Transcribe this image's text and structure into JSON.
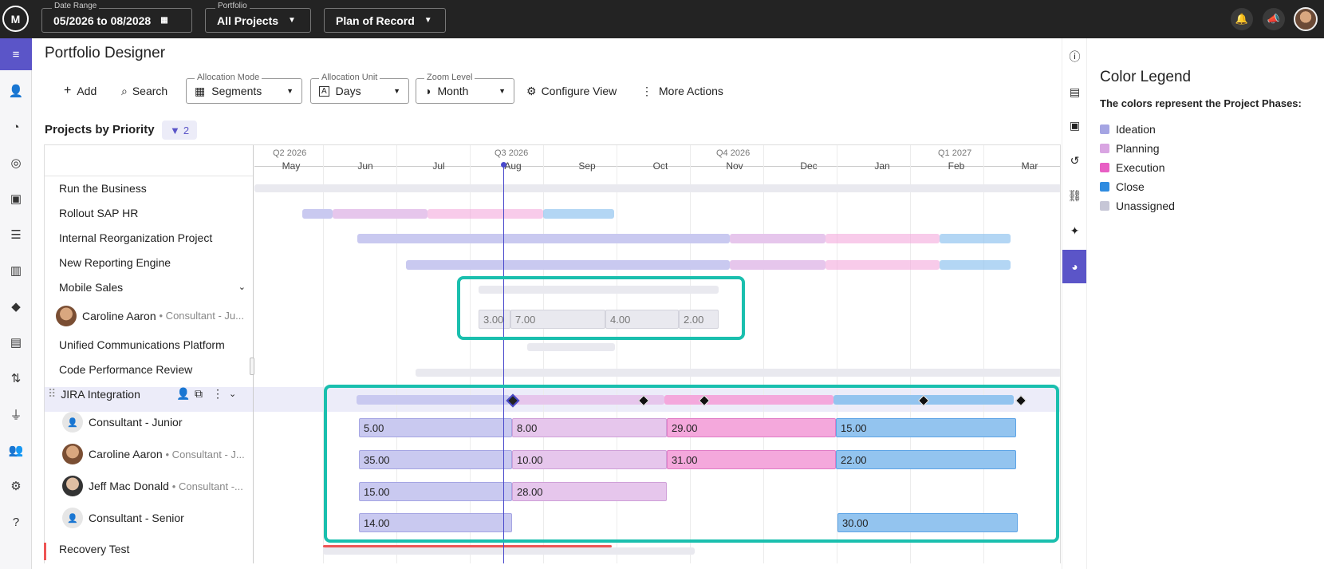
{
  "topbar": {
    "logo_text": "M",
    "date_range": {
      "label": "Date Range",
      "value": "05/2026 to 08/2028"
    },
    "portfolio": {
      "label": "Portfolio",
      "value": "All Projects"
    },
    "scenario": {
      "value": "Plan of Record"
    }
  },
  "page": {
    "title": "Portfolio Designer"
  },
  "toolbar": {
    "add_label": "Add",
    "search_label": "Search",
    "allocation_mode": {
      "label": "Allocation Mode",
      "value": "Segments"
    },
    "allocation_unit": {
      "label": "Allocation Unit",
      "value": "Days"
    },
    "zoom_level": {
      "label": "Zoom Level",
      "value": "Month"
    },
    "configure_label": "Configure View",
    "more_label": "More Actions"
  },
  "section": {
    "title": "Projects by Priority",
    "filter_count": "2"
  },
  "timeline": {
    "quarters": [
      "Q2 2026",
      "Q3 2026",
      "Q4 2026",
      "Q1 2027"
    ],
    "months": [
      "May",
      "Jun",
      "Jul",
      "Aug",
      "Sep",
      "Oct",
      "Nov",
      "Dec",
      "Jan",
      "Feb",
      "Mar"
    ]
  },
  "rows": [
    {
      "name": "Run the Business"
    },
    {
      "name": "Rollout SAP HR"
    },
    {
      "name": "Internal Reorganization Project"
    },
    {
      "name": "New Reporting Engine"
    },
    {
      "name": "Mobile Sales"
    },
    {
      "name": "Caroline Aaron",
      "sub": "• Consultant - Ju..."
    },
    {
      "name": "Unified Communications Platform"
    },
    {
      "name": "Code Performance Review"
    },
    {
      "name": "JIRA Integration"
    },
    {
      "name": "Consultant - Junior"
    },
    {
      "name": "Caroline Aaron",
      "sub": "• Consultant - J..."
    },
    {
      "name": "Jeff Mac Donald",
      "sub": "• Consultant -..."
    },
    {
      "name": "Consultant - Senior"
    },
    {
      "name": "Recovery Test"
    }
  ],
  "allocations": {
    "mobile_caroline": [
      "3.00",
      "7.00",
      "4.00",
      "2.00"
    ],
    "jira_junior": [
      "5.00",
      "8.00",
      "29.00",
      "15.00"
    ],
    "jira_caroline": [
      "35.00",
      "10.00",
      "31.00",
      "22.00"
    ],
    "jira_jeff": [
      "15.00",
      "28.00"
    ],
    "jira_senior": [
      "14.00",
      "30.00"
    ]
  },
  "legend": {
    "title": "Color Legend",
    "subtitle": "The colors represent the Project Phases:",
    "items": [
      {
        "label": "Ideation",
        "color": "#a5a5e3"
      },
      {
        "label": "Planning",
        "color": "#d9a5e2"
      },
      {
        "label": "Execution",
        "color": "#e85fc4"
      },
      {
        "label": "Close",
        "color": "#2f8be0"
      },
      {
        "label": "Unassigned",
        "color": "#c6c6d6"
      }
    ]
  }
}
